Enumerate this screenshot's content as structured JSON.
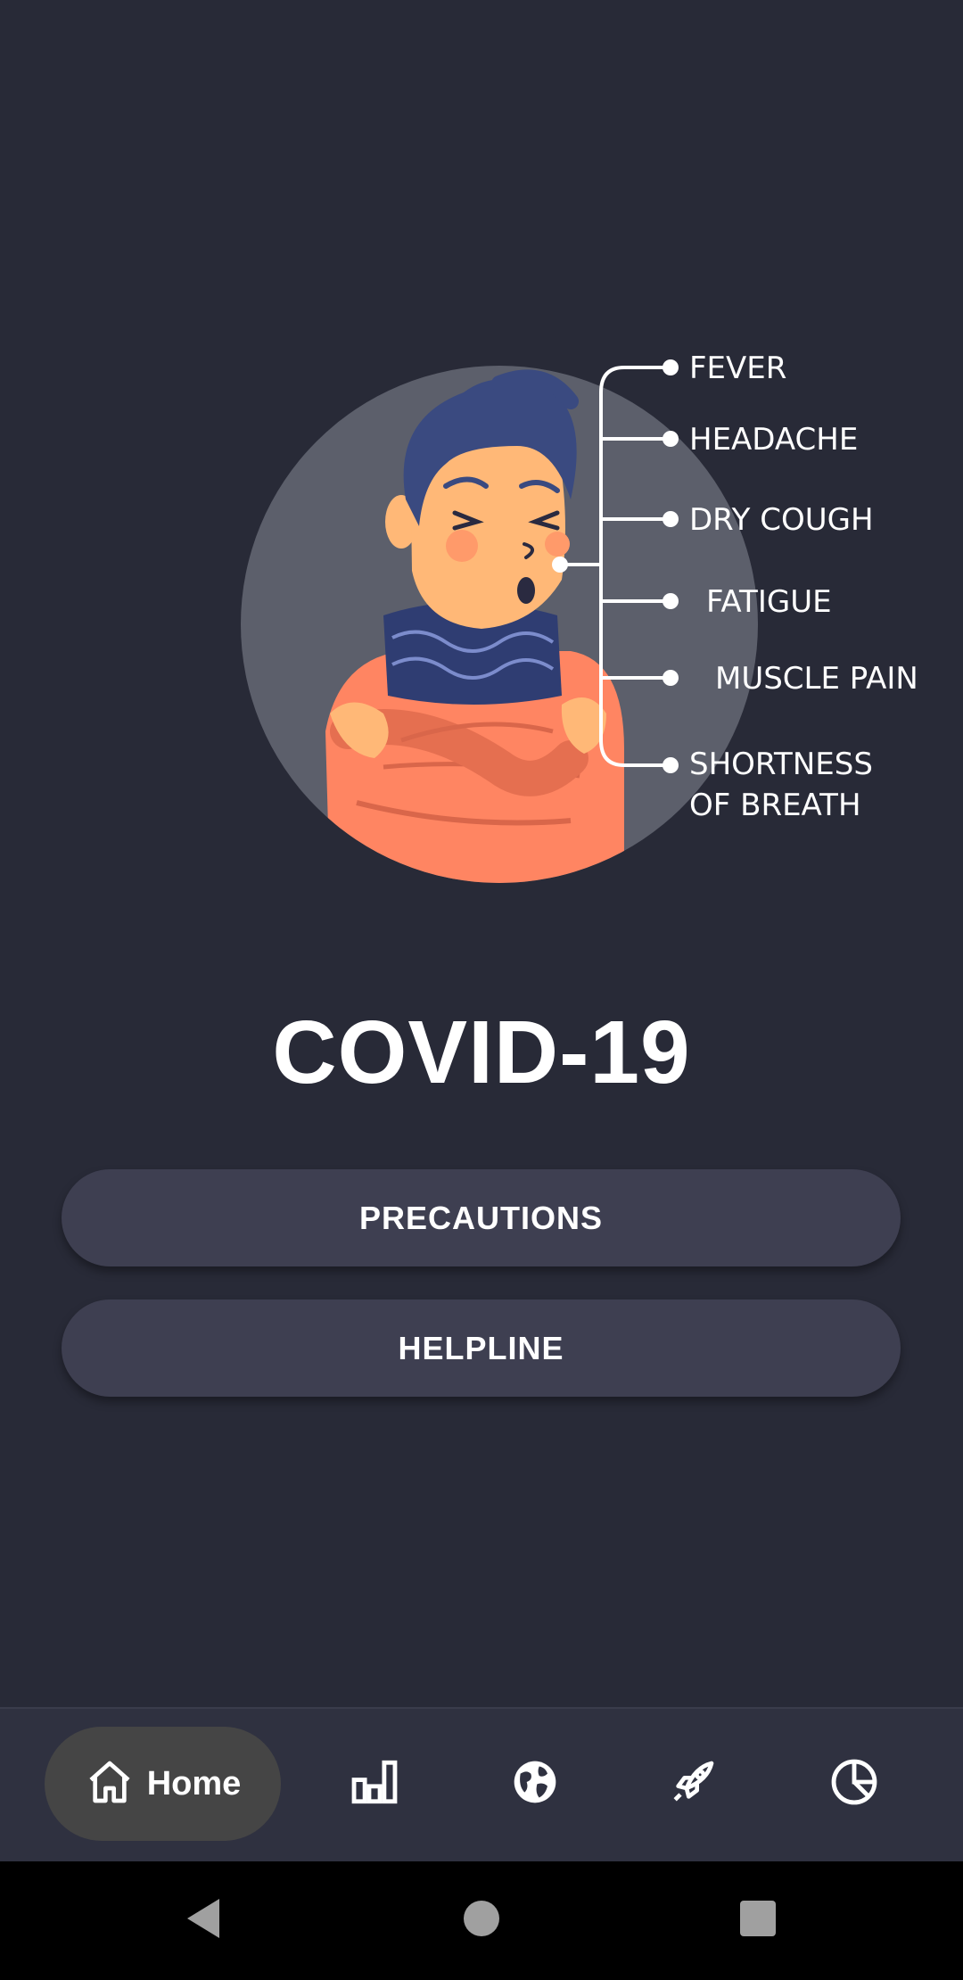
{
  "illustration": {
    "symptoms": [
      {
        "lines": [
          "FEVER"
        ]
      },
      {
        "lines": [
          "HEADACHE"
        ]
      },
      {
        "lines": [
          "DRY COUGH"
        ]
      },
      {
        "lines": [
          "FATIGUE"
        ]
      },
      {
        "lines": [
          "MUSCLE PAIN"
        ]
      },
      {
        "lines": [
          "SHORTNESS",
          "OF BREATH"
        ]
      }
    ],
    "colors": {
      "circle": "#5c5f6b",
      "hair": "#3a4a80",
      "skin": "#ffb877",
      "cheek": "#ff9a6a",
      "scarf": "#2f3d72",
      "sweater": "#ff8562",
      "line": "#ffffff"
    }
  },
  "main": {
    "title": "COVID-19",
    "buttons": {
      "precautions_label": "PRECAUTIONS",
      "helpline_label": "HELPLINE"
    }
  },
  "bottom_nav": {
    "items": [
      {
        "label": "Home",
        "icon": "home-icon",
        "selected": true
      },
      {
        "label": "",
        "icon": "bar-chart-icon",
        "selected": false
      },
      {
        "label": "",
        "icon": "globe-icon",
        "selected": false
      },
      {
        "label": "",
        "icon": "rocket-icon",
        "selected": false
      },
      {
        "label": "",
        "icon": "pie-chart-icon",
        "selected": false
      }
    ],
    "colors": {
      "background": "#2f3140",
      "selected_pill": "#454545"
    }
  },
  "system_nav": {
    "items": [
      {
        "icon": "back-triangle-icon"
      },
      {
        "icon": "home-circle-icon"
      },
      {
        "icon": "recents-square-icon"
      }
    ]
  },
  "theme": {
    "background": "#282a37",
    "button": "#3e3f51",
    "text": "#ffffff"
  }
}
